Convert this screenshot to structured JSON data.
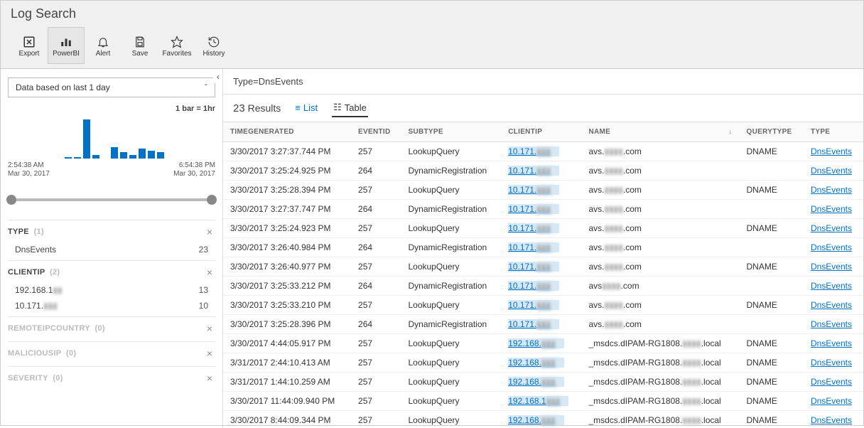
{
  "title": "Log Search",
  "toolbar": [
    {
      "name": "export",
      "label": "Export",
      "icon": "x-square-icon"
    },
    {
      "name": "powerbi",
      "label": "PowerBI",
      "icon": "chart-bar-icon",
      "active": true
    },
    {
      "name": "alert",
      "label": "Alert",
      "icon": "bell-icon"
    },
    {
      "name": "save",
      "label": "Save",
      "icon": "floppy-icon"
    },
    {
      "name": "favorites",
      "label": "Favorites",
      "icon": "star-icon"
    },
    {
      "name": "history",
      "label": "History",
      "icon": "history-icon"
    }
  ],
  "sidebar": {
    "date_basis": "Data based on last 1 day",
    "bar_legend": "1 bar = 1hr",
    "chart_data": {
      "type": "bar",
      "values": [
        2,
        2,
        48,
        4,
        0,
        14,
        8,
        4,
        12,
        10,
        8
      ],
      "start": {
        "time": "2:54:38 AM",
        "date": "Mar 30, 2017"
      },
      "end": {
        "time": "6:54:38 PM",
        "date": "Mar 30, 2017"
      },
      "ylabel": "",
      "xlabel": ""
    },
    "facets": [
      {
        "name": "TYPE",
        "count": "(1)",
        "dim": false,
        "items": [
          {
            "label": "DnsEvents",
            "value": "23"
          }
        ]
      },
      {
        "name": "CLIENTIP",
        "count": "(2)",
        "dim": false,
        "items": [
          {
            "label": "192.168.1",
            "blurred_tail": "▮▮",
            "value": "13"
          },
          {
            "label": "10.171.",
            "blurred_tail": "▮▮▮",
            "value": "10"
          }
        ]
      },
      {
        "name": "REMOTEIPCOUNTRY",
        "count": "(0)",
        "dim": true,
        "items": []
      },
      {
        "name": "MALICIOUSIP",
        "count": "(0)",
        "dim": true,
        "items": []
      },
      {
        "name": "SEVERITY",
        "count": "(0)",
        "dim": true,
        "items": []
      }
    ]
  },
  "query": "Type=DnsEvents",
  "results_count": "23",
  "results_label": "Results",
  "view_list": "List",
  "view_table": "Table",
  "columns": [
    "TIMEGENERATED",
    "EVENTID",
    "SUBTYPE",
    "CLIENTIP",
    "NAME",
    "QUERYTYPE",
    "TYPE"
  ],
  "rows": [
    {
      "time": "3/30/2017 3:27:37.744 PM",
      "eventid": "257",
      "subtype": "LookupQuery",
      "ip": "10.171.",
      "name": "avs.▮▮▮▮.com",
      "qtype": "DNAME",
      "type": "DnsEvents"
    },
    {
      "time": "3/30/2017 3:25:24.925 PM",
      "eventid": "264",
      "subtype": "DynamicRegistration",
      "ip": "10.171.",
      "name": "avs.▮▮▮▮.com",
      "qtype": "",
      "type": "DnsEvents"
    },
    {
      "time": "3/30/2017 3:25:28.394 PM",
      "eventid": "257",
      "subtype": "LookupQuery",
      "ip": "10.171.",
      "name": "avs.▮▮▮▮.com",
      "qtype": "DNAME",
      "type": "DnsEvents"
    },
    {
      "time": "3/30/2017 3:27:37.747 PM",
      "eventid": "264",
      "subtype": "DynamicRegistration",
      "ip": "10.171.",
      "name": "avs.▮▮▮▮.com",
      "qtype": "",
      "type": "DnsEvents"
    },
    {
      "time": "3/30/2017 3:25:24.923 PM",
      "eventid": "257",
      "subtype": "LookupQuery",
      "ip": "10.171.",
      "name": "avs.▮▮▮▮.com",
      "qtype": "DNAME",
      "type": "DnsEvents"
    },
    {
      "time": "3/30/2017 3:26:40.984 PM",
      "eventid": "264",
      "subtype": "DynamicRegistration",
      "ip": "10.171.",
      "name": "avs.▮▮▮▮.com",
      "qtype": "",
      "type": "DnsEvents"
    },
    {
      "time": "3/30/2017 3:26:40.977 PM",
      "eventid": "257",
      "subtype": "LookupQuery",
      "ip": "10.171.",
      "name": "avs.▮▮▮▮.com",
      "qtype": "DNAME",
      "type": "DnsEvents"
    },
    {
      "time": "3/30/2017 3:25:33.212 PM",
      "eventid": "264",
      "subtype": "DynamicRegistration",
      "ip": "10.171.",
      "name": "avs▮▮▮▮.com",
      "qtype": "",
      "type": "DnsEvents"
    },
    {
      "time": "3/30/2017 3:25:33.210 PM",
      "eventid": "257",
      "subtype": "LookupQuery",
      "ip": "10.171.",
      "name": "avs.▮▮▮▮.com",
      "qtype": "DNAME",
      "type": "DnsEvents"
    },
    {
      "time": "3/30/2017 3:25:28.396 PM",
      "eventid": "264",
      "subtype": "DynamicRegistration",
      "ip": "10.171.",
      "name": "avs.▮▮▮▮.com",
      "qtype": "",
      "type": "DnsEvents"
    },
    {
      "time": "3/30/2017 4:44:05.917 PM",
      "eventid": "257",
      "subtype": "LookupQuery",
      "ip": "192.168.",
      "name": "_msdcs.dIPAM-RG1808.▮▮▮▮.local",
      "qtype": "DNAME",
      "type": "DnsEvents"
    },
    {
      "time": "3/31/2017 2:44:10.413 AM",
      "eventid": "257",
      "subtype": "LookupQuery",
      "ip": "192.168.",
      "name": "_msdcs.dIPAM-RG1808.▮▮▮▮.local",
      "qtype": "DNAME",
      "type": "DnsEvents"
    },
    {
      "time": "3/31/2017 1:44:10.259 AM",
      "eventid": "257",
      "subtype": "LookupQuery",
      "ip": "192.168.",
      "name": "_msdcs.dIPAM-RG1808.▮▮▮▮.local",
      "qtype": "DNAME",
      "type": "DnsEvents"
    },
    {
      "time": "3/30/2017 11:44:09.940 PM",
      "eventid": "257",
      "subtype": "LookupQuery",
      "ip": "192.168.1",
      "name": "_msdcs.dIPAM-RG1808.▮▮▮▮.local",
      "qtype": "DNAME",
      "type": "DnsEvents"
    },
    {
      "time": "3/30/2017 8:44:09.344 PM",
      "eventid": "257",
      "subtype": "LookupQuery",
      "ip": "192.168.",
      "name": "_msdcs.dIPAM-RG1808.▮▮▮▮.local",
      "qtype": "DNAME",
      "type": "DnsEvents"
    }
  ],
  "icons": {
    "x-square-icon": "⧈",
    "chart-bar-icon": "◫",
    "bell-icon": "🔔",
    "floppy-icon": "💾",
    "star-icon": "☆",
    "history-icon": "↺",
    "chevron": "ˇ",
    "chevron-left": "‹",
    "list-icon": "≡",
    "table-icon": "☷",
    "close": "×",
    "sort-down": "↓"
  }
}
